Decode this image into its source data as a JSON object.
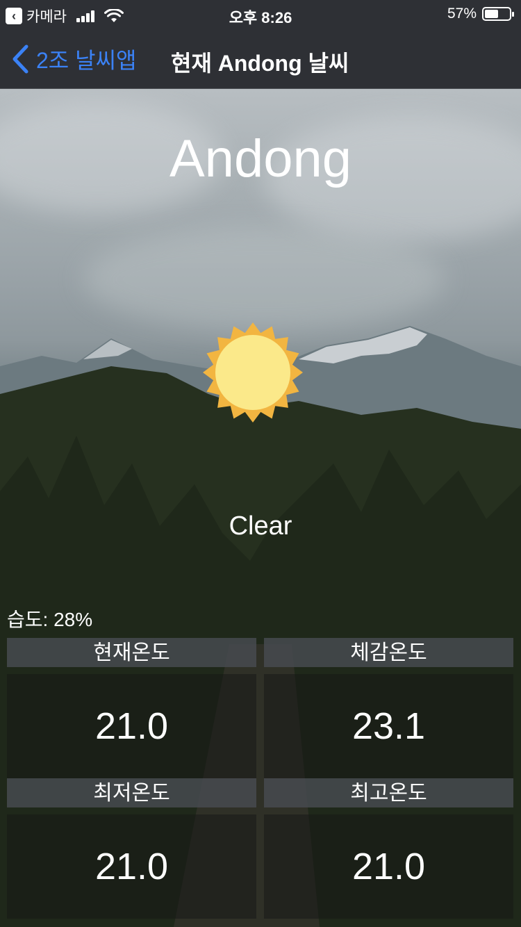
{
  "status_bar": {
    "carrier": "카메라",
    "time": "오후 8:26",
    "battery_percent": "57%",
    "battery_level": 0.57
  },
  "nav": {
    "back_label": "2조 날씨앱",
    "title": "현재 Andong 날씨"
  },
  "weather": {
    "city": "Andong",
    "condition": "Clear",
    "icon": "sun-icon",
    "humidity": "습도: 28%"
  },
  "temperatures": {
    "current": {
      "label": "현재온도",
      "value": "21.0"
    },
    "feels_like": {
      "label": "체감온도",
      "value": "23.1"
    },
    "min": {
      "label": "최저온도",
      "value": "21.0"
    },
    "max": {
      "label": "최고온도",
      "value": "21.0"
    }
  },
  "colors": {
    "accent": "#3b82f6",
    "sun_outer": "#f2b541",
    "sun_inner": "#fbe98a"
  }
}
